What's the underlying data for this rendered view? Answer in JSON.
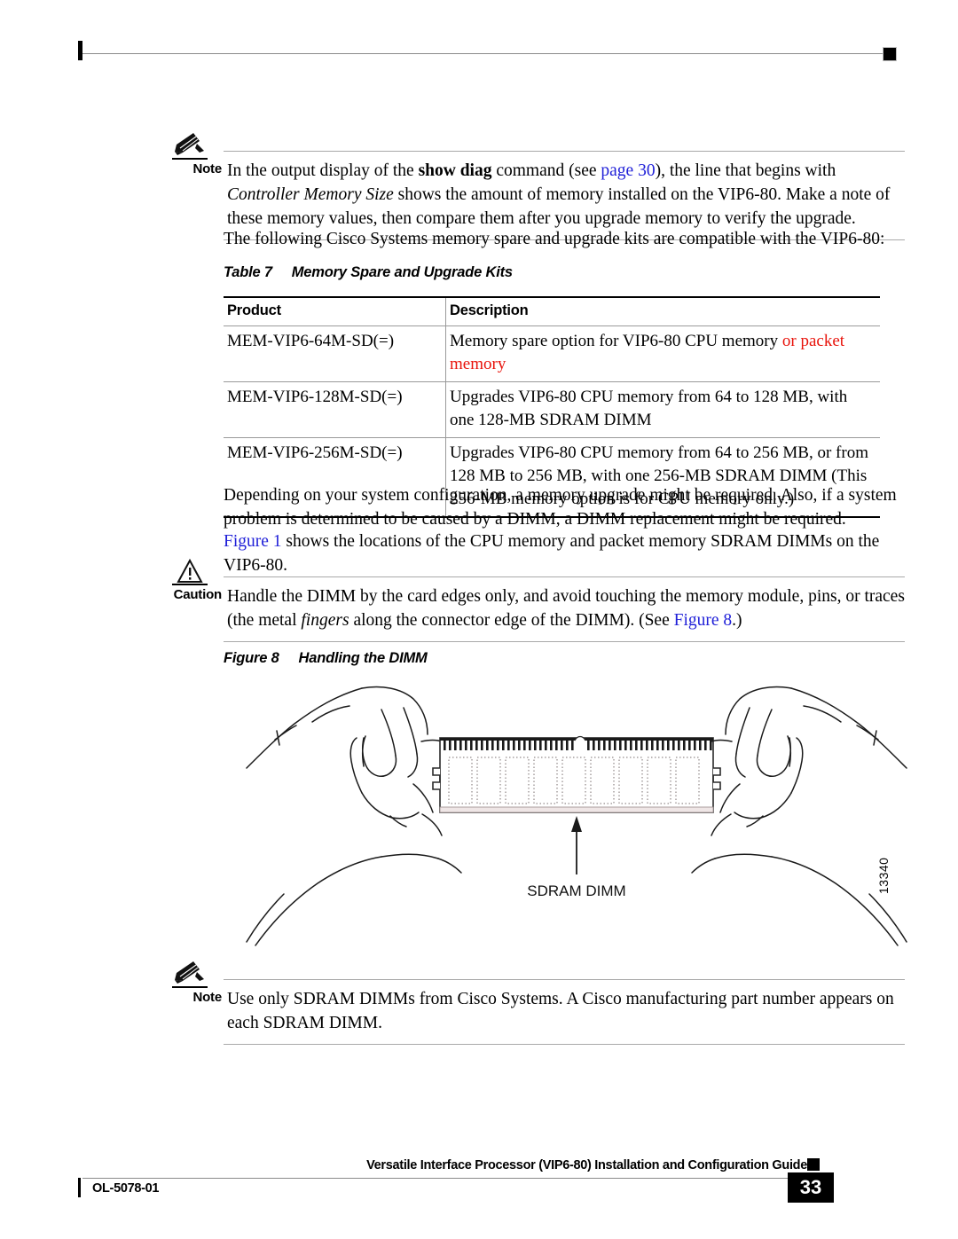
{
  "page": {
    "number": "33",
    "doc_id": "OL-5078-01",
    "footer_title": "Versatile Interface Processor (VIP6-80) Installation and Configuration Guide"
  },
  "note_top": {
    "label": "Note",
    "icon": "pencil-note-icon",
    "text_parts": {
      "p1": "In the output display of the ",
      "cmd": "show diag",
      "p2": " command (see ",
      "link": "page 30",
      "p3": "), the line that begins with ",
      "em1": "Controller Memory Size",
      "p4": " shows the amount of memory installed on the VIP6-80. Make a note of these memory values, then compare them after you upgrade memory to verify the upgrade."
    }
  },
  "intro_paragraph": "The following Cisco Systems memory spare and upgrade kits are compatible with the VIP6-80:",
  "table": {
    "caption_label": "Table 7",
    "caption_title": "Memory Spare and Upgrade Kits",
    "headers": [
      "Product",
      "Description"
    ],
    "rows": [
      {
        "product": "MEM-VIP6-64M-SD(=)",
        "description_plain": "Memory spare option for VIP6-80 CPU memory ",
        "description_red": "or packet memory"
      },
      {
        "product": "MEM-VIP6-128M-SD(=)",
        "description_plain": "Upgrades VIP6-80 CPU memory from 64 to 128 MB, with one 128-MB SDRAM DIMM",
        "description_red": ""
      },
      {
        "product": "MEM-VIP6-256M-SD(=)",
        "description_plain": "Upgrades VIP6-80 CPU memory from 64 to 256 MB, or from 128 MB to 256 MB, with one 256-MB SDRAM DIMM (This 256-MB memory option is for CPU memory only.)",
        "description_red": ""
      }
    ]
  },
  "body_paragraph_1": "Depending on your system configuration, a memory upgrade might be required. Also, if a system problem is determined to be caused by a DIMM, a DIMM replacement might be required.",
  "body_paragraph_2": {
    "link": "Figure 1",
    "rest": " shows the locations of the CPU memory and packet memory SDRAM DIMMs on the VIP6-80."
  },
  "caution": {
    "label": "Caution",
    "icon": "warning-triangle-icon",
    "text_parts": {
      "p1": "Handle the DIMM by the card edges only, and avoid touching the memory module, pins, or traces (the metal ",
      "em1": "fingers",
      "p2": " along the connector edge of the DIMM). (See ",
      "link": "Figure 8",
      "p3": ".)"
    }
  },
  "figure": {
    "caption_label": "Figure 8",
    "caption_title": "Handling the DIMM",
    "callout_label": "SDRAM DIMM",
    "art_id": "13340",
    "chip_count": 9
  },
  "note_bottom": {
    "label": "Note",
    "icon": "pencil-note-icon",
    "text": "Use only SDRAM DIMMs from Cisco Systems. A Cisco manufacturing part number appears on each SDRAM DIMM."
  },
  "colors": {
    "link": "#2020d8",
    "highlight": "#e8130b",
    "rule": "#9a9a9a"
  }
}
